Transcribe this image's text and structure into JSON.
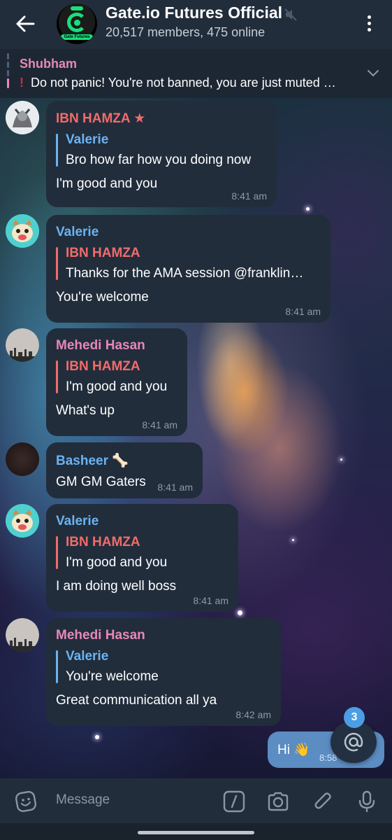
{
  "header": {
    "title": "Gate.io Futures Official",
    "members_text": "20,517 members, ",
    "online_text": "475 online",
    "avatar_label": "Gate Futures"
  },
  "pinned": {
    "sender": "Shubham",
    "text": "Do not panic! You're not banned, you are just muted …"
  },
  "messages": [
    {
      "sender": "IBN HAMZA",
      "badge": "★",
      "reply_to": "Valerie",
      "reply_text": "Bro how far how you doing now",
      "text": "I'm good and you",
      "time": "8:41 am"
    },
    {
      "sender": "Valerie",
      "reply_to": "IBN HAMZA",
      "reply_text": "Thanks for the AMA session @franklin…",
      "text": "You're welcome",
      "time": "8:41 am"
    },
    {
      "sender": "Mehedi Hasan",
      "reply_to": "IBN HAMZA",
      "reply_text": "I'm good and you",
      "text": "What's up",
      "time": "8:41 am"
    },
    {
      "sender": "Basheer",
      "badge": "🦴",
      "text": "GM GM Gaters",
      "time": "8:41 am"
    },
    {
      "sender": "Valerie",
      "reply_to": "IBN HAMZA",
      "reply_text": "I'm good and you",
      "text": "I am doing well boss",
      "time": "8:41 am"
    },
    {
      "sender": "Mehedi Hasan",
      "reply_to": "Valerie",
      "reply_text": "You're welcome",
      "text": "Great communication all ya",
      "time": "8:42 am"
    }
  ],
  "own_message": {
    "text": "Hi 👋",
    "time": "8:58"
  },
  "mention_count": "3",
  "input": {
    "placeholder": "Message"
  },
  "colors": {
    "header_bg": "#212d3b",
    "bubble_bg": "#212d3b",
    "own_bubble_bg": "#5b8cc2",
    "name_red": "#f26b6b",
    "name_blue": "#6ab3f3",
    "name_pink": "#e788b6",
    "accent_green": "#17e07a"
  },
  "icons": {
    "back": "arrow-left-icon",
    "mute": "speaker-muted-icon",
    "more": "more-vertical-icon",
    "chevron": "chevron-down-icon",
    "emoji": "sticker-icon",
    "commands": "slash-command-icon",
    "camera": "camera-icon",
    "attach": "paperclip-icon",
    "mic": "microphone-icon",
    "mention": "at-sign-icon"
  }
}
